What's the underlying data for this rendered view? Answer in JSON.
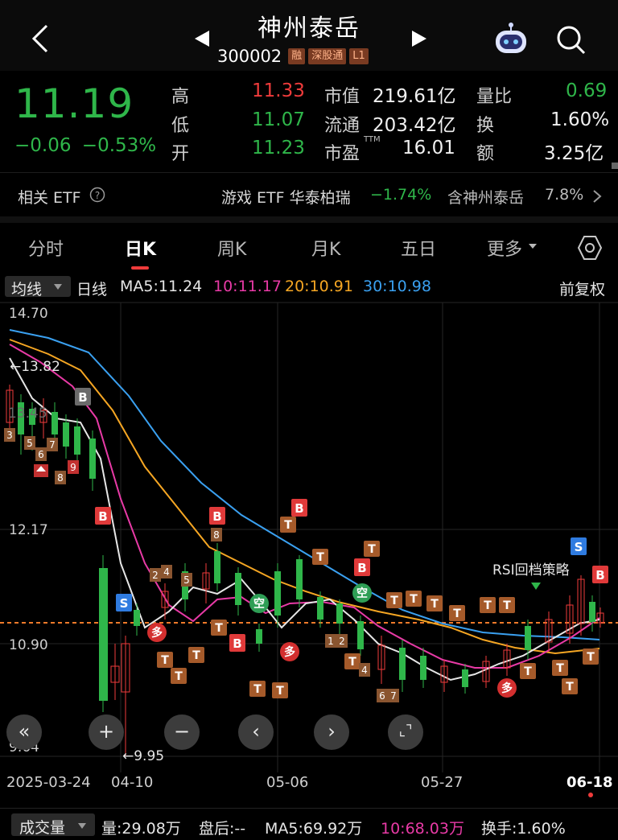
{
  "header": {
    "title": "神州泰岳",
    "code": "300002",
    "tags": [
      "融",
      "深股通",
      "L1"
    ],
    "prev_icon": "caret-left",
    "next_icon": "caret-right",
    "back_icon": "chevron-left",
    "robot_icon": "robot-assistant",
    "search_icon": "search"
  },
  "quote": {
    "price": "11.19",
    "change": "−0.06",
    "change_pct": "−0.53%",
    "high_label": "高",
    "high": "11.33",
    "low_label": "低",
    "low": "11.07",
    "open_label": "开",
    "open": "11.23",
    "mktcap_label": "市值",
    "mktcap": "219.61亿",
    "float_label": "流通",
    "float": "203.42亿",
    "pe_label": "市盈",
    "pe_sup": "TTM",
    "pe": "16.01",
    "vol_ratio_label": "量比",
    "vol_ratio": "0.69",
    "turnover_label": "换",
    "turnover": "1.60%",
    "amount_label": "额",
    "amount": "3.25亿",
    "colors": {
      "up": "#ef3b3b",
      "down": "#2fb64a"
    }
  },
  "etf": {
    "label": "相关 ETF",
    "help_icon": "question-circle",
    "name": "游戏 ETF 华泰柏瑞",
    "change": "−1.74%",
    "contains": "含神州泰岳",
    "weight": "7.8%"
  },
  "tabs": [
    "分时",
    "日K",
    "周K",
    "月K",
    "五日",
    "更多"
  ],
  "active_tab": "日K",
  "indicator": {
    "selector": "均线",
    "period": "日线",
    "ma5": "MA5:11.24",
    "ma10": "10:11.17",
    "ma20": "20:10.91",
    "ma30": "30:10.98",
    "adjust": "前复权",
    "colors": {
      "ma5": "#e6e6e6",
      "ma10": "#e83aa6",
      "ma20": "#f5a623",
      "ma30": "#3aa0f0"
    }
  },
  "chart": {
    "y_labels": [
      "14.70",
      "12.17",
      "10.90",
      "9.64"
    ],
    "x_labels": [
      "2025-03-24",
      "04-10",
      "05-06",
      "05-27",
      "06-18"
    ],
    "max_marker": "←13.82",
    "min_marker": "←9.95",
    "partial_label": "13.45",
    "strategy_label": "RSI回档策略",
    "controls": [
      "«",
      "+",
      "−",
      "‹",
      "›",
      "⌞⌝"
    ]
  },
  "volume_row": {
    "selector": "成交量",
    "vol": "量:29.08万",
    "after": "盘后:--",
    "ma5": "MA5:69.92万",
    "ma10": "10:68.03万",
    "turnover": "换手:1.60%"
  },
  "chart_data": {
    "type": "candlestick",
    "ylim": [
      9.64,
      14.7
    ],
    "x_ticks": [
      "2025-03-24",
      "04-10",
      "05-06",
      "05-27",
      "06-18"
    ],
    "max_price": 13.82,
    "min_price": 9.95,
    "last_close": 11.19,
    "series": [
      {
        "name": "MA5",
        "value": 11.24
      },
      {
        "name": "10",
        "value": 11.17
      },
      {
        "name": "20",
        "value": 10.91
      },
      {
        "name": "30",
        "value": 10.98
      }
    ]
  }
}
